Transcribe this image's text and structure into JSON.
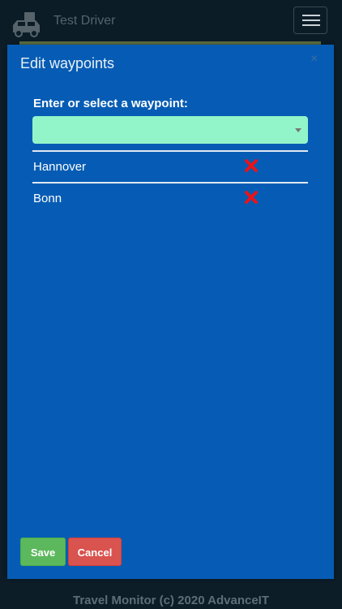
{
  "navbar": {
    "brand_text": "Test Driver",
    "brand_icon": "car-icon",
    "menu_icon": "hamburger-menu-icon"
  },
  "modal": {
    "title": "Edit waypoints",
    "close_symbol": "×",
    "field_label": "Enter or select a waypoint:",
    "select_value": "",
    "waypoints": [
      {
        "label": "Hannover",
        "remove_icon": "remove-x-icon"
      },
      {
        "label": "Bonn",
        "remove_icon": "remove-x-icon"
      }
    ],
    "save_label": "Save",
    "cancel_label": "Cancel"
  },
  "footer": {
    "text": "Travel Monitor (c) 2020 AdvanceIT"
  },
  "colors": {
    "modal_bg": "#065cb4",
    "select_bg": "#92f5c9",
    "save": "#5cb85c",
    "cancel": "#d9534f",
    "remove": "#e8141a"
  }
}
